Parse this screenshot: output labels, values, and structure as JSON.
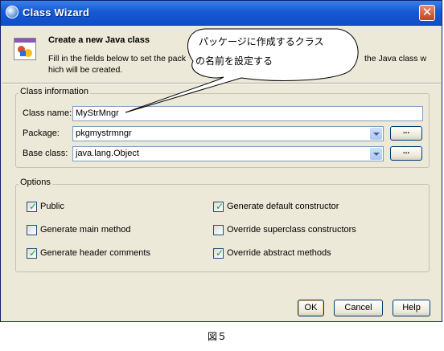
{
  "window": {
    "title": "Class Wizard",
    "close_symbol": "✕"
  },
  "header": {
    "title": "Create a new Java class",
    "description_line1_start": "Fill in the fields below to set the pack",
    "description_line1_end": "the Java class w",
    "description_line2": "hich will be created."
  },
  "class_info": {
    "group_label": "Class information",
    "class_name_label": "Class name:",
    "class_name_value": "MyStrMngr",
    "package_label": "Package:",
    "package_value": "pkgmystrmngr",
    "base_class_label": "Base class:",
    "base_class_value": "java.lang.Object",
    "browse_label": "..."
  },
  "options": {
    "group_label": "Options",
    "items": [
      {
        "label": "Public",
        "checked": true
      },
      {
        "label": "Generate default constructor",
        "checked": true
      },
      {
        "label": "Generate main method",
        "checked": false
      },
      {
        "label": "Override superclass constructors",
        "checked": false
      },
      {
        "label": "Generate header comments",
        "checked": true
      },
      {
        "label": "Override abstract methods",
        "checked": true
      }
    ],
    "check_symbol": "✓"
  },
  "buttons": {
    "ok": "OK",
    "cancel": "Cancel",
    "help": "Help"
  },
  "callout": {
    "line1": "パッケージに作成するクラス",
    "line2": "の名前を設定する"
  },
  "caption": "図５",
  "colors": {
    "titlebar": "#0f4fc7",
    "dialog_bg": "#ece9d8",
    "check_green": "#21a121"
  }
}
